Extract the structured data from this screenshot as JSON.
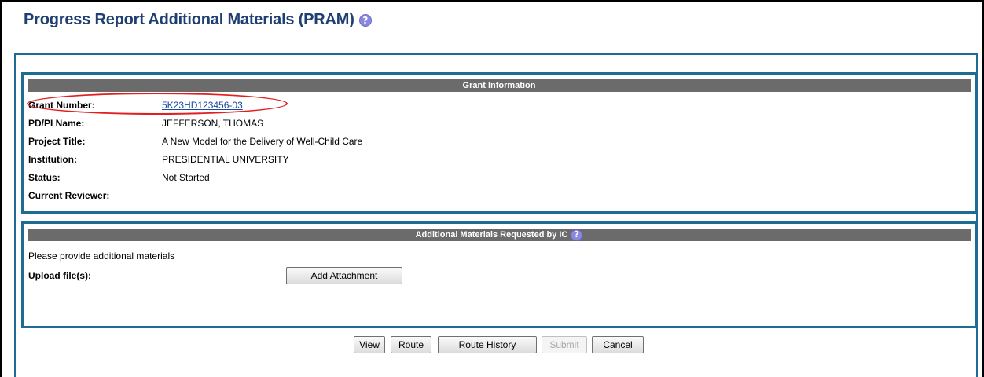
{
  "page": {
    "title": "Progress Report Additional Materials (PRAM)",
    "help_icon": "question-circle-icon"
  },
  "grant_info": {
    "header": "Grant Information",
    "rows": [
      {
        "label": "Grant Number:",
        "value": "5K23HD123456-03"
      },
      {
        "label": "PD/PI Name:",
        "value": "JEFFERSON, THOMAS"
      },
      {
        "label": "Project Title:",
        "value": "A New Model for the Delivery of Well-Child Care"
      },
      {
        "label": "Institution:",
        "value": "PRESIDENTIAL UNIVERSITY"
      },
      {
        "label": "Status:",
        "value": "Not Started"
      },
      {
        "label": "Current Reviewer:",
        "value": ""
      }
    ]
  },
  "materials": {
    "header": "Additional Materials Requested by IC",
    "help_icon": "question-circle-icon",
    "instructions": "Please provide additional materials",
    "upload_label": "Upload file(s):",
    "add_attachment_label": "Add Attachment"
  },
  "actions": {
    "view": "View",
    "route": "Route",
    "route_history": "Route History",
    "submit": "Submit",
    "cancel": "Cancel"
  },
  "colors": {
    "title": "#1f3f73",
    "border": "#1f6c92",
    "header_bg": "#6b6b6b",
    "highlight": "#e02020"
  }
}
